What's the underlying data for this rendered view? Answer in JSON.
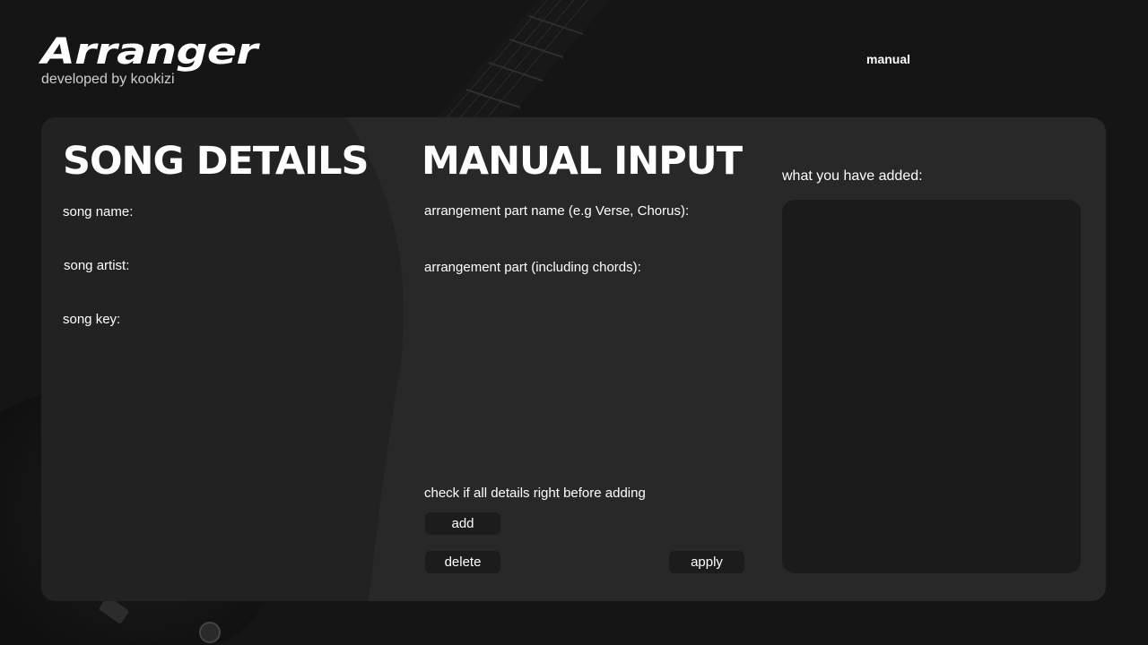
{
  "brand": {
    "title": "Arranger",
    "subtitle": "developed by kookizi"
  },
  "nav": {
    "manual_label": "manual"
  },
  "song_details": {
    "heading": "SONG DETAILS",
    "name_label": "song name:",
    "artist_label": "song artist:",
    "key_label": "song key:"
  },
  "manual_input": {
    "heading": "MANUAL INPUT",
    "part_name_label": "arrangement part name (e.g Verse, Chorus):",
    "part_label": "arrangement part (including chords):",
    "check_note": "check if all details right before adding",
    "add_label": "add",
    "delete_label": "delete",
    "apply_label": "apply"
  },
  "added": {
    "label": "what you have added:"
  },
  "colors": {
    "background": "#151515",
    "panel": "#282828",
    "button": "#1c1c1c",
    "added_box": "#1b1b1b"
  }
}
